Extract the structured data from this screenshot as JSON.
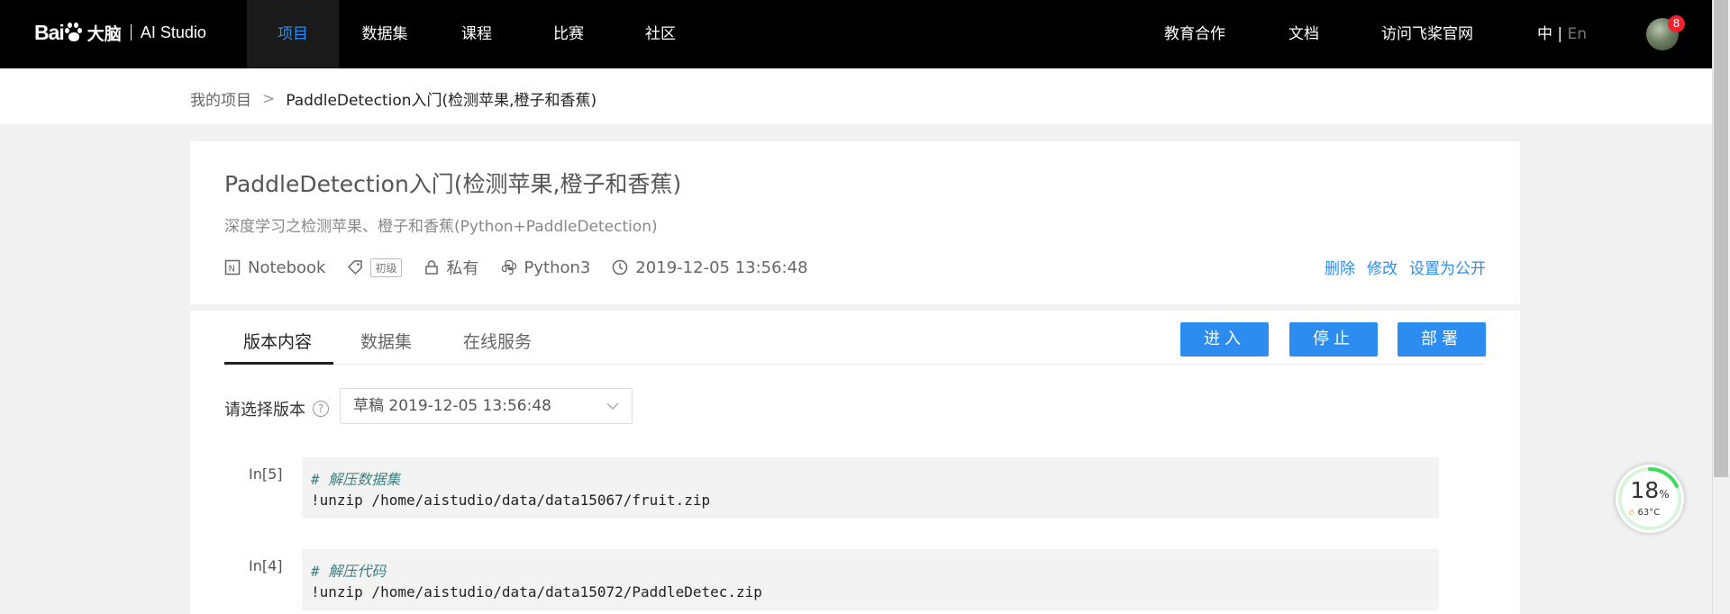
{
  "brand": {
    "bai": "Bai",
    "du": "大脑",
    "product": "AI Studio"
  },
  "nav": {
    "items": [
      {
        "label": "项目",
        "active": true
      },
      {
        "label": "数据集",
        "active": false
      },
      {
        "label": "课程",
        "active": false
      },
      {
        "label": "比赛",
        "active": false
      },
      {
        "label": "社区",
        "active": false
      }
    ],
    "right": {
      "edu": "教育合作",
      "docs": "文档",
      "site": "访问飞桨官网"
    },
    "lang": {
      "zh": "中",
      "sep": "|",
      "en": "En"
    },
    "notification_count": "8",
    "accent": "#2d8cf0"
  },
  "breadcrumb": {
    "root": "我的项目",
    "sep": ">",
    "current": "PaddleDetection入门(检测苹果,橙子和香蕉)"
  },
  "project": {
    "title": "PaddleDetection入门(检测苹果,橙子和香蕉)",
    "description": "深度学习之检测苹果、橙子和香蕉(Python+PaddleDetection)",
    "type": "Notebook",
    "level": "初级",
    "visibility": "私有",
    "env": "Python3",
    "created": "2019-12-05 13:56:48",
    "actions": {
      "delete": "删除",
      "edit": "修改",
      "make_public": "设置为公开"
    }
  },
  "tabs": [
    {
      "label": "版本内容",
      "active": true
    },
    {
      "label": "数据集",
      "active": false
    },
    {
      "label": "在线服务",
      "active": false
    }
  ],
  "buttons": {
    "enter": "进入",
    "stop": "停止",
    "deploy": "部署"
  },
  "version": {
    "label": "请选择版本",
    "help": "?",
    "selected": "草稿 2019-12-05 13:56:48"
  },
  "cells": [
    {
      "prompt": "In[5]",
      "comment": "# 解压数据集",
      "code": "!unzip /home/aistudio/data/data15067/fruit.zip"
    },
    {
      "prompt": "In[4]",
      "comment": "# 解压代码",
      "code": "!unzip /home/aistudio/data/data15072/PaddleDetec.zip"
    }
  ],
  "monitor": {
    "percent": "18",
    "percent_unit": "%",
    "temperature": "63°C",
    "fill_fraction": 0.18
  }
}
